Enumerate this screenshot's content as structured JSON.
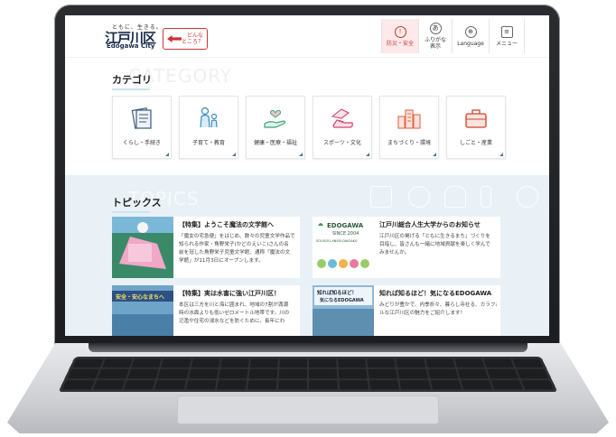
{
  "header": {
    "logo_tagline": "ともに、生きる。",
    "logo_mark": "江戸川区",
    "logo_en": "Edogawa City",
    "donna_line1": "どんな",
    "donna_line2": "ところ？",
    "buttons": [
      {
        "label1": "防災・安全",
        "label2": "",
        "icon": "!"
      },
      {
        "label1": "ふりがな",
        "label2": "表示",
        "icon": "あ"
      },
      {
        "label1": "Language",
        "label2": "",
        "icon": "⊕"
      },
      {
        "label1": "メニュー",
        "label2": "",
        "icon": "≡"
      }
    ]
  },
  "category": {
    "bg_word": "CATEGORY",
    "title": "カテゴリ",
    "items": [
      {
        "label": "くらし・手続き",
        "icon": "documents-icon"
      },
      {
        "label": "子育て・教育",
        "icon": "family-icon"
      },
      {
        "label": "健康・医療・福祉",
        "icon": "care-hand-icon"
      },
      {
        "label": "スポーツ・文化",
        "icon": "sneaker-fan-icon"
      },
      {
        "label": "まちづくり・環境",
        "icon": "buildings-icon"
      },
      {
        "label": "しごと・産業",
        "icon": "briefcase-icon"
      }
    ]
  },
  "topics": {
    "bg_word": "TOPICS",
    "title": "トピックス",
    "items": [
      {
        "title": "【特集】ようこそ魔法の文学館へ",
        "lines": [
          "「魔女の宅急便」をはじめ、数々の児童文学作品で",
          "知られる作家・角野栄子(かどのえいこ)さんの名",
          "前を冠した角野栄子児童文学館、通称「魔法の文",
          "学館」が11月3日にオープンします。"
        ]
      },
      {
        "title": "江戸川総合人生大学からのお知らせ",
        "lines": [
          "江戸川区の掲げる「ともに生きるまち」づくりを",
          "目指し、皆さんも一緒に地域貢献を楽しく学んで",
          "みませんか。"
        ],
        "thumb_head": "EDOGAWA",
        "thumb_sub": "SINCE 2004",
        "thumb_en": "SOUGOU-JINSEI-DAIGAKU"
      },
      {
        "title": "【特集】実は水害に強い江戸川区！",
        "lines": [
          "本区は三方を川と海に囲まれ、地域の7割が満潮",
          "時の水面よりも低いゼロメートル地帯です。川の",
          "氾濫や住宅の浸水などを防ぐために、長年にわ"
        ],
        "thumb_head": "安全・安心なまちへ"
      },
      {
        "title": "知れば知るほど！気になるEDOGAWA",
        "lines": [
          "みどりが豊かで、内季折々、暮らし寺社る、カラフル",
          "ルな江戸川区の魅力をご紹介します！"
        ],
        "thumb_head": "知れば知るほど！",
        "thumb_sub": "気になるEDOGAWA"
      }
    ]
  },
  "colors": {
    "brand_navy": "#1a2a4a",
    "alert_red": "#c0392b",
    "topics_bg": "#e9f1f6"
  }
}
